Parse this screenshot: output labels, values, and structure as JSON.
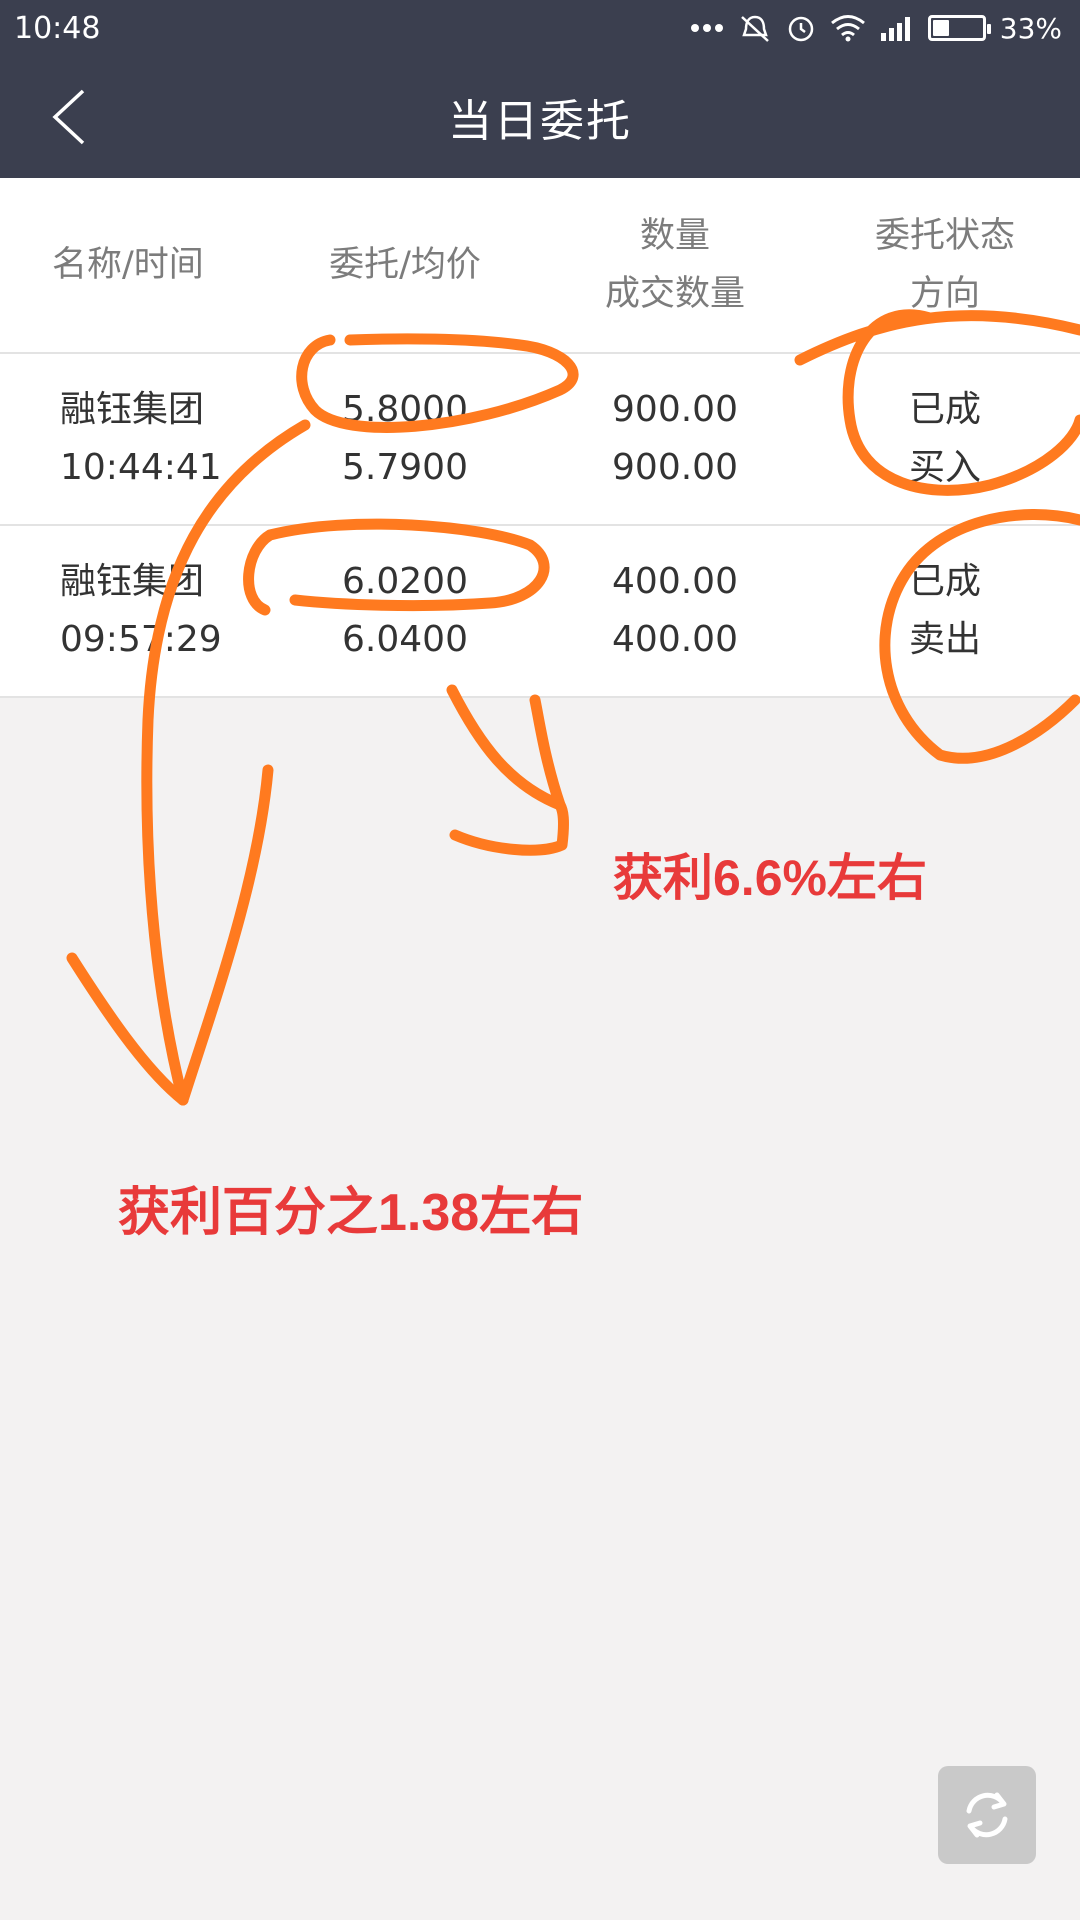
{
  "status_bar": {
    "time": "10:48",
    "battery_text": "33%",
    "battery_level": 0.33,
    "icons": [
      "more-dots-icon",
      "vibrate-off-icon",
      "alarm-icon",
      "wifi-icon",
      "signal-icon",
      "battery-icon"
    ]
  },
  "nav": {
    "title": "当日委托",
    "back_icon": "chevron-left-icon"
  },
  "table": {
    "headers": {
      "col1": "名称/时间",
      "col2": "委托/均价",
      "col3_line1": "数量",
      "col3_line2": "成交数量",
      "col4_line1": "委托状态",
      "col4_line2": "方向"
    },
    "rows": [
      {
        "name": "融钰集团",
        "time": "10:44:41",
        "order_price": "5.8000",
        "avg_price": "5.7900",
        "quantity": "900.00",
        "filled_quantity": "900.00",
        "status": "已成",
        "direction": "买入"
      },
      {
        "name": "融钰集团",
        "time": "09:57:29",
        "order_price": "6.0200",
        "avg_price": "6.0400",
        "quantity": "400.00",
        "filled_quantity": "400.00",
        "status": "已成",
        "direction": "卖出"
      }
    ]
  },
  "annotations": {
    "note1": "获利6.6%左右",
    "note2": "获利百分之1.38左右",
    "color": "#e83a3a",
    "stroke_color": "#ff7a1f"
  },
  "refresh_icon": "refresh-icon",
  "colors": {
    "header_bg": "#3b3f4f",
    "page_bg": "#f3f2f2",
    "table_bg": "#ffffff"
  }
}
